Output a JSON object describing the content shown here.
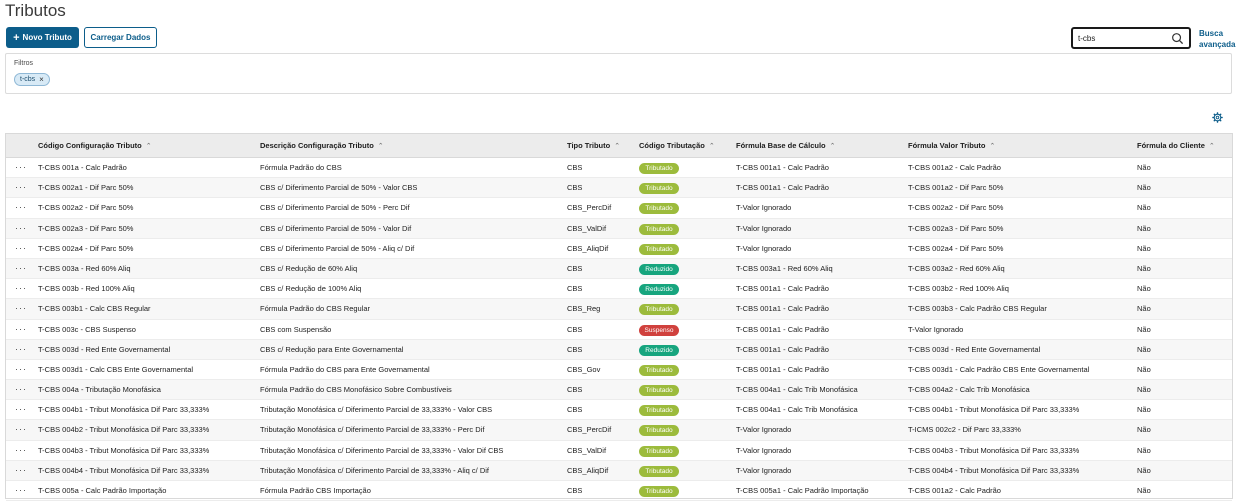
{
  "page": {
    "title": "Tributos"
  },
  "toolbar": {
    "new_label": "Novo Tributo",
    "load_label": "Carregar Dados"
  },
  "search": {
    "value": "t-cbs",
    "advanced_line1": "Busca",
    "advanced_line2": "avançada"
  },
  "filters": {
    "label": "Filtros",
    "chips": [
      "t-cbs"
    ]
  },
  "colors": {
    "primary": "#0c5d8a",
    "tributado": "#9cbb3c",
    "reduzido": "#17a57e",
    "suspenso": "#d0413d"
  },
  "table": {
    "columns": [
      "Código Configuração Tributo",
      "Descrição Configuração Tributo",
      "Tipo Tributo",
      "Código Tributação",
      "Fórmula Base de Cálculo",
      "Fórmula Valor Tributo",
      "Fórmula do Cliente"
    ],
    "rows": [
      [
        "T-CBS 001a - Calc Padrão",
        "Fórmula Padrão do CBS",
        "CBS",
        "Tributado",
        "T-CBS 001a1 - Calc Padrão",
        "T-CBS 001a2 - Calc Padrão",
        "Não"
      ],
      [
        "T-CBS 002a1 - Dif Parc 50%",
        "CBS c/ Diferimento Parcial de 50% - Valor CBS",
        "CBS",
        "Tributado",
        "T-CBS 001a1 - Calc Padrão",
        "T-CBS 001a2 - Dif Parc 50%",
        "Não"
      ],
      [
        "T-CBS 002a2 - Dif Parc 50%",
        "CBS c/ Diferimento Parcial de 50% - Perc Dif",
        "CBS_PercDif",
        "Tributado",
        "T-Valor Ignorado",
        "T-CBS 002a2 - Dif Parc 50%",
        "Não"
      ],
      [
        "T-CBS 002a3 - Dif Parc 50%",
        "CBS c/ Diferimento Parcial de 50% - Valor Dif",
        "CBS_ValDif",
        "Tributado",
        "T-Valor Ignorado",
        "T-CBS 002a3 - Dif Parc 50%",
        "Não"
      ],
      [
        "T-CBS 002a4 - Dif Parc 50%",
        "CBS c/ Diferimento Parcial de 50% - Aliq c/ Dif",
        "CBS_AliqDif",
        "Tributado",
        "T-Valor Ignorado",
        "T-CBS 002a4 - Dif Parc 50%",
        "Não"
      ],
      [
        "T-CBS 003a - Red 60% Aliq",
        "CBS c/ Redução de 60% Aliq",
        "CBS",
        "Reduzido",
        "T-CBS 003a1 - Red 60% Aliq",
        "T-CBS 003a2 - Red 60% Aliq",
        "Não"
      ],
      [
        "T-CBS 003b - Red 100% Aliq",
        "CBS c/ Redução de 100% Aliq",
        "CBS",
        "Reduzido",
        "T-CBS 001a1 - Calc Padrão",
        "T-CBS 003b2 - Red 100% Aliq",
        "Não"
      ],
      [
        "T-CBS 003b1 - Calc CBS Regular",
        "Fórmula Padrão do CBS Regular",
        "CBS_Reg",
        "Tributado",
        "T-CBS 001a1 - Calc Padrão",
        "T-CBS 003b3 - Calc Padrão CBS Regular",
        "Não"
      ],
      [
        "T-CBS 003c - CBS Suspenso",
        "CBS com Suspensão",
        "CBS",
        "Suspenso",
        "T-CBS 001a1 - Calc Padrão",
        "T-Valor Ignorado",
        "Não"
      ],
      [
        "T-CBS 003d - Red Ente Governamental",
        "CBS c/ Redução para Ente Governamental",
        "CBS",
        "Reduzido",
        "T-CBS 001a1 - Calc Padrão",
        "T-CBS 003d - Red Ente Governamental",
        "Não"
      ],
      [
        "T-CBS 003d1 - Calc CBS Ente Governamental",
        "Fórmula Padrão do CBS para Ente Governamental",
        "CBS_Gov",
        "Tributado",
        "T-CBS 001a1 - Calc Padrão",
        "T-CBS 003d1 - Calc Padrão CBS Ente Governamental",
        "Não"
      ],
      [
        "T-CBS 004a - Tributação Monofásica",
        "Fórmula Padrão do CBS Monofásico Sobre Combustíveis",
        "CBS",
        "Tributado",
        "T-CBS 004a1 - Calc Trib Monofásica",
        "T-CBS 004a2 - Calc Trib Monofásica",
        "Não"
      ],
      [
        "T-CBS 004b1 - Tribut Monofásica Dif Parc 33,333%",
        "Tributação Monofásica c/ Diferimento Parcial de 33,333% - Valor CBS",
        "CBS",
        "Tributado",
        "T-CBS 004a1 - Calc Trib Monofásica",
        "T-CBS 004b1 - Tribut Monofásica Dif Parc 33,333%",
        "Não"
      ],
      [
        "T-CBS 004b2 - Tribut Monofásica Dif Parc 33,333%",
        "Tributação Monofásica c/ Diferimento Parcial de 33,333% - Perc Dif",
        "CBS_PercDif",
        "Tributado",
        "T-Valor Ignorado",
        "T-ICMS 002c2 - Dif Parc 33,333%",
        "Não"
      ],
      [
        "T-CBS 004b3 - Tribut Monofásica Dif Parc 33,333%",
        "Tributação Monofásica c/ Diferimento Parcial de 33,333% - Valor Dif CBS",
        "CBS_ValDif",
        "Tributado",
        "T-Valor Ignorado",
        "T-CBS 004b3 - Tribut Monofásica Dif Parc 33,333%",
        "Não"
      ],
      [
        "T-CBS 004b4 - Tribut Monofásica Dif Parc 33,333%",
        "Tributação Monofásica c/ Diferimento Parcial de 33,333% - Aliq c/ Dif",
        "CBS_AliqDif",
        "Tributado",
        "T-Valor Ignorado",
        "T-CBS 004b4 - Tribut Monofásica Dif Parc 33,333%",
        "Não"
      ],
      [
        "T-CBS 005a - Calc Padrão Importação",
        "Fórmula Padrão CBS Importação",
        "CBS",
        "Tributado",
        "T-CBS 005a1 - Calc Padrão Importação",
        "T-CBS 001a2 - Calc Padrão",
        "Não"
      ]
    ]
  }
}
